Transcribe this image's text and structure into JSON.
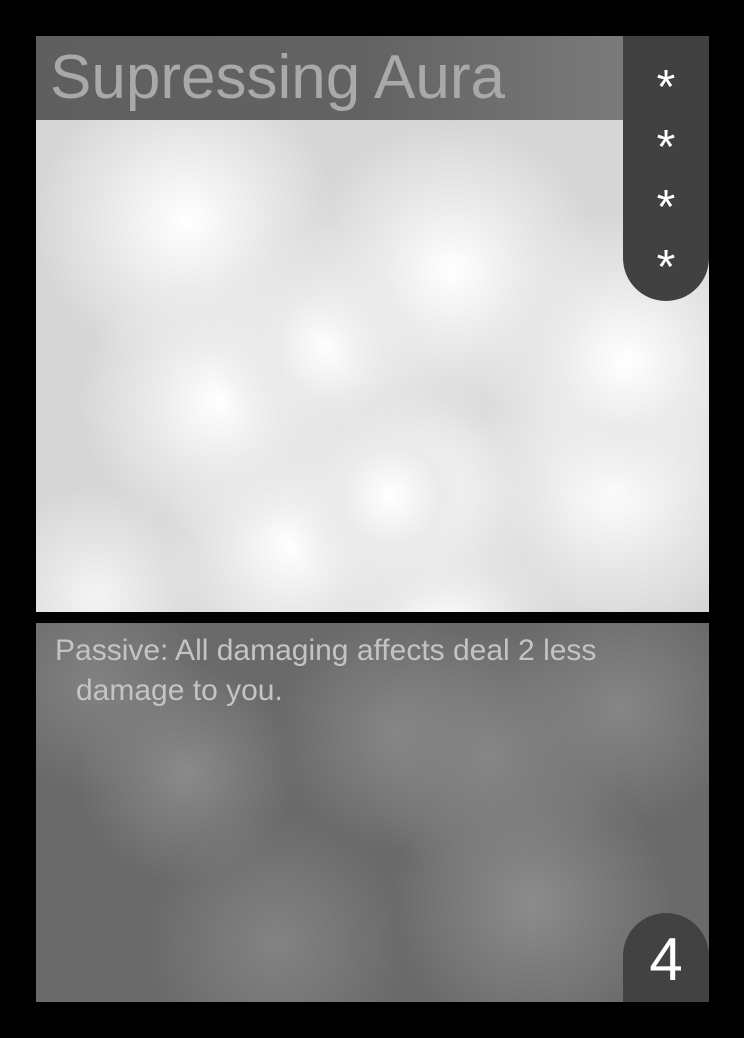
{
  "card": {
    "title": "Supressing Aura",
    "cost_stars": [
      "*",
      "*",
      "*",
      "*"
    ],
    "rules_text": "Passive: All damaging affects deal 2 less damage to you.",
    "number": "4"
  },
  "colors": {
    "background": "#000000",
    "title_bar": "#626262",
    "title_text": "#a9a9a9",
    "cost_tab": "#414141",
    "star": "#ffffff",
    "art_base": "#d6d6d6",
    "text_panel": "#6a6a6a",
    "rules_text": "#c4c4c4",
    "number_tab": "#424242",
    "number_text": "#ffffff"
  }
}
